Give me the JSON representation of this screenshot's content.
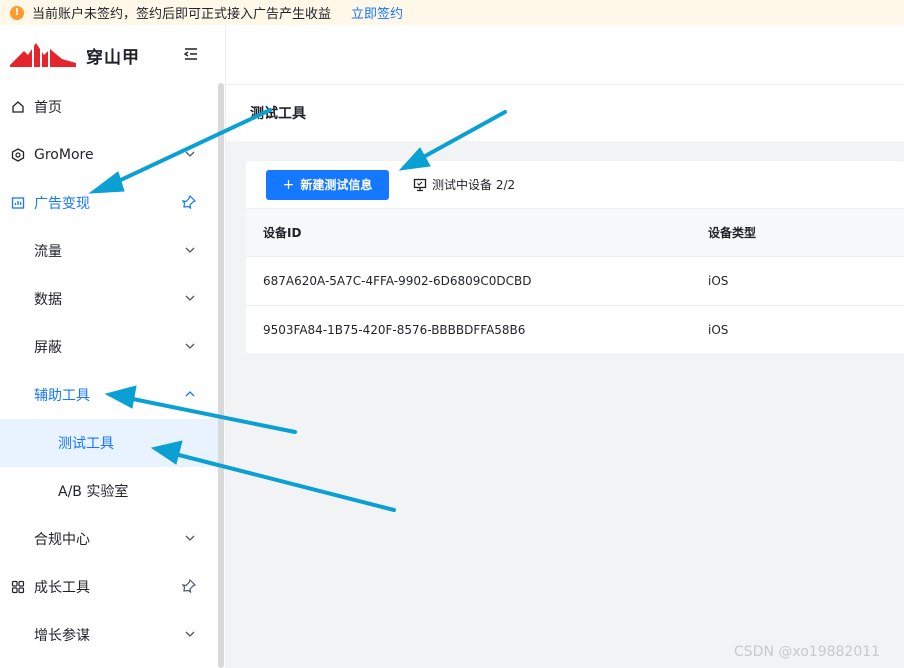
{
  "notice": {
    "text": "当前账户未签约，签约后即可正式接入广告产生收益",
    "link": "立即签约"
  },
  "brand": {
    "name": "穿山甲"
  },
  "menu": [
    {
      "label": "首页",
      "icon": "home-icon"
    },
    {
      "label": "GroMore",
      "icon": "gromore-icon"
    },
    {
      "label": "广告变现",
      "icon": "chart-icon"
    },
    {
      "label": "流量"
    },
    {
      "label": "数据"
    },
    {
      "label": "屏蔽"
    },
    {
      "label": "辅助工具"
    },
    {
      "label": "测试工具"
    },
    {
      "label": "A/B 实验室"
    },
    {
      "label": "合规中心"
    },
    {
      "label": "成长工具",
      "icon": "grid-icon"
    },
    {
      "label": "增长参谋"
    }
  ],
  "page": {
    "title": "测试工具",
    "new_button": "新建测试信息",
    "device_status": "测试中设备 2/2"
  },
  "table": {
    "headers": [
      "设备ID",
      "设备类型"
    ],
    "rows": [
      [
        "687A620A-5A7C-4FFA-9902-6D6809C0DCBD",
        "iOS"
      ],
      [
        "9503FA84-1B75-420F-8576-BBBBDFFA58B6",
        "iOS"
      ]
    ]
  },
  "watermark": "CSDN @xo19882011",
  "colors": {
    "accent": "#1677ff",
    "annotation_arrow": "#0aa0d4",
    "brand_red": "#e4262c"
  }
}
